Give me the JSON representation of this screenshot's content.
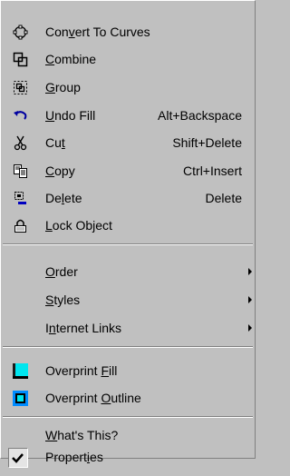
{
  "menu": {
    "items": [
      {
        "pre": "Con",
        "acc": "v",
        "post": "ert To Curves",
        "shortcut": "",
        "icon": "convert-to-curves-icon"
      },
      {
        "pre": "",
        "acc": "C",
        "post": "ombine",
        "shortcut": "",
        "icon": "combine-icon"
      },
      {
        "pre": "",
        "acc": "G",
        "post": "roup",
        "shortcut": "",
        "icon": "group-icon"
      },
      {
        "pre": "",
        "acc": "U",
        "post": "ndo Fill",
        "shortcut": "Alt+Backspace",
        "icon": "undo-icon"
      },
      {
        "pre": "Cu",
        "acc": "t",
        "post": "",
        "shortcut": "Shift+Delete",
        "icon": "scissors-icon"
      },
      {
        "pre": "",
        "acc": "C",
        "post": "opy",
        "shortcut": "Ctrl+Insert",
        "icon": "copy-icon"
      },
      {
        "pre": "De",
        "acc": "l",
        "post": "ete",
        "shortcut": "Delete",
        "icon": "delete-icon"
      },
      {
        "pre": "",
        "acc": "L",
        "post": "ock Object",
        "shortcut": "",
        "icon": "lock-icon"
      },
      {
        "pre": "",
        "acc": "O",
        "post": "rder",
        "shortcut": "",
        "icon": ""
      },
      {
        "pre": "",
        "acc": "S",
        "post": "tyles",
        "shortcut": "",
        "icon": ""
      },
      {
        "pre": "I",
        "acc": "n",
        "post": "ternet Links",
        "shortcut": "",
        "icon": ""
      },
      {
        "pre": "Overprint ",
        "acc": "F",
        "post": "ill",
        "shortcut": "",
        "icon": "overprint-fill-icon"
      },
      {
        "pre": "Overprint ",
        "acc": "O",
        "post": "utline",
        "shortcut": "",
        "icon": "overprint-outline-icon"
      },
      {
        "pre": "",
        "acc": "W",
        "post": "hat's This?",
        "shortcut": "",
        "icon": ""
      },
      {
        "pre": "Propert",
        "acc": "i",
        "post": "es",
        "shortcut": "",
        "icon": "checkmark-icon"
      }
    ]
  },
  "colors": {
    "menu_bg": "#c0c0c0",
    "overprint_fill_cyan": "#00e5ee",
    "overprint_outline_blue": "#008cff"
  }
}
